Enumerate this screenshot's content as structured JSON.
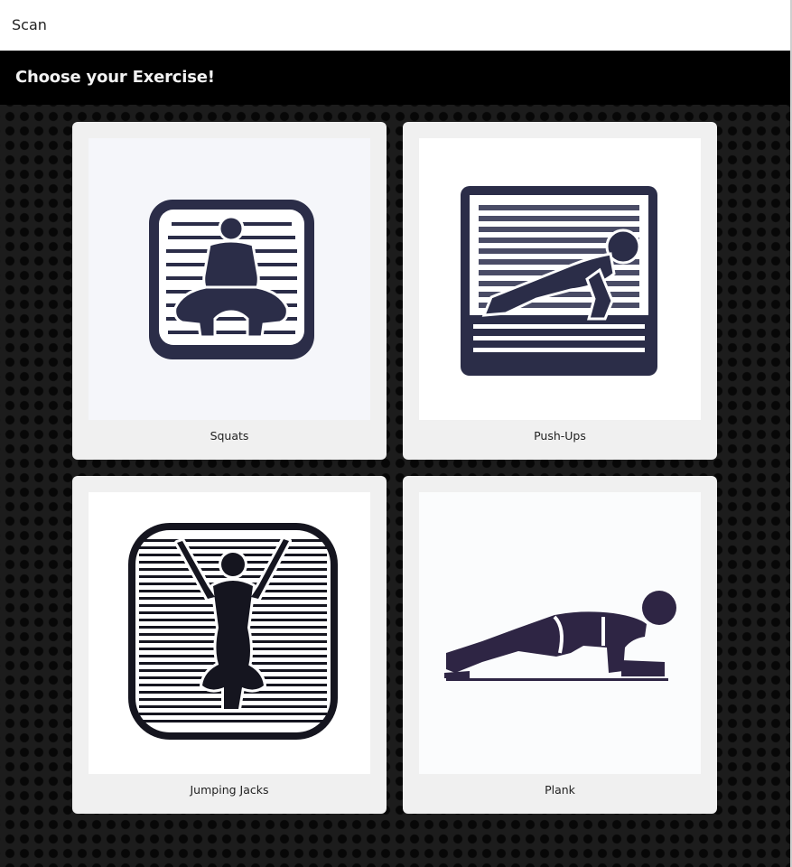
{
  "window": {
    "title": "Scan"
  },
  "header": {
    "title": "Choose your Exercise!"
  },
  "exercises": [
    {
      "label": "Squats",
      "icon": "squat-icon",
      "bg": "#f5f6fa"
    },
    {
      "label": "Push-Ups",
      "icon": "push-up-icon",
      "bg": "#ffffff"
    },
    {
      "label": "Jumping Jacks",
      "icon": "jumping-jacks-icon",
      "bg": "#ffffff"
    },
    {
      "label": "Plank",
      "icon": "plank-icon",
      "bg": "#fbfcfd"
    }
  ],
  "colors": {
    "header_bg": "#000000",
    "card_bg": "#f0f0f0",
    "icon_navy": "#2b2d48",
    "icon_dark": "#15151f",
    "icon_purple": "#2e2544"
  }
}
